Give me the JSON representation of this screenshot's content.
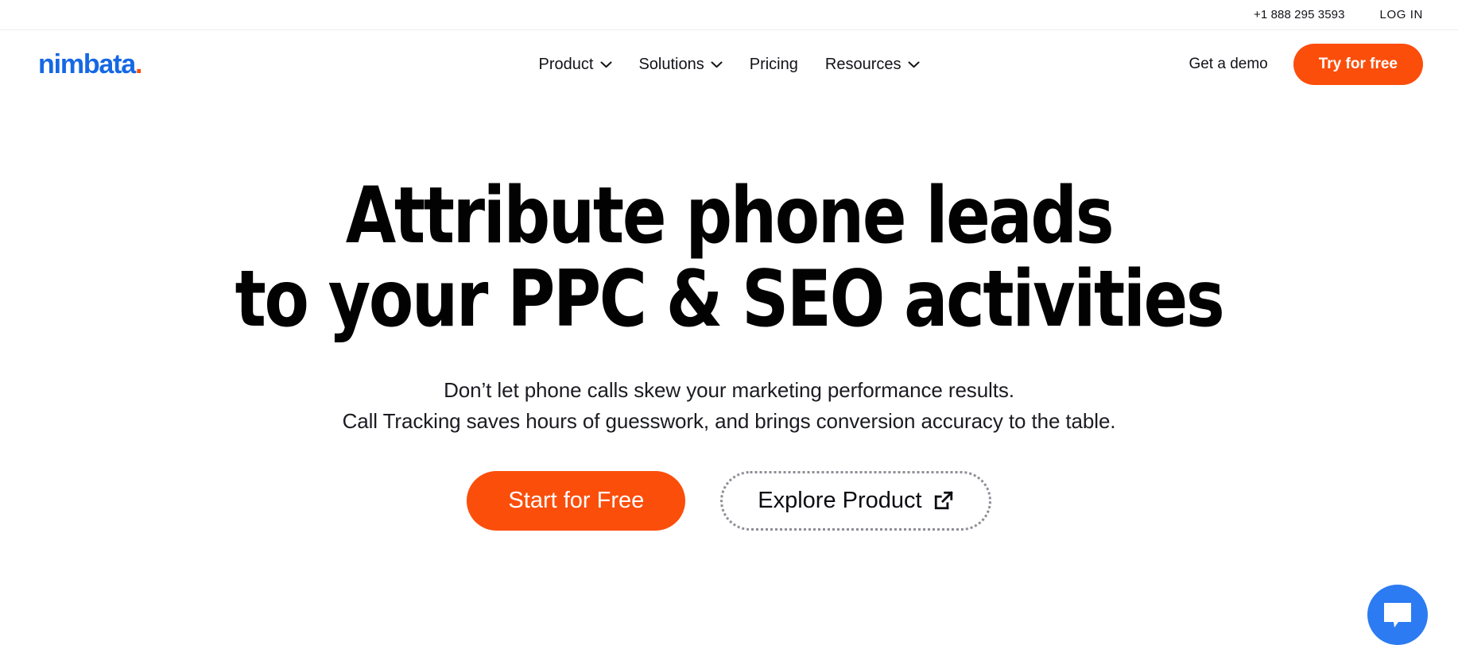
{
  "topbar": {
    "phone": "+1 888 295 3593",
    "login_label": "LOG IN"
  },
  "header": {
    "logo_text": "nimbata",
    "logo_dot": ".",
    "nav_items": [
      {
        "label": "Product",
        "has_chevron": true
      },
      {
        "label": "Solutions",
        "has_chevron": true
      },
      {
        "label": "Pricing",
        "has_chevron": false
      },
      {
        "label": "Resources",
        "has_chevron": true
      }
    ],
    "demo_label": "Get a demo",
    "try_label": "Try for free"
  },
  "hero": {
    "title_line1": "Attribute phone leads",
    "title_line2": "to your PPC & SEO activities",
    "sub_line1": "Don’t let phone calls skew your marketing performance results.",
    "sub_line2": "Call Tracking saves hours of guesswork, and brings conversion accuracy to the table.",
    "cta_primary": "Start for Free",
    "cta_secondary": "Explore Product"
  },
  "colors": {
    "brand_blue": "#1668e3",
    "accent_orange": "#fb4e0b",
    "chat_blue": "#2c7bf2",
    "text_dark": "#121218"
  },
  "icons": {
    "chevron": "chevron-down-icon",
    "external": "external-link-icon",
    "chat": "chat-bubble-icon"
  }
}
